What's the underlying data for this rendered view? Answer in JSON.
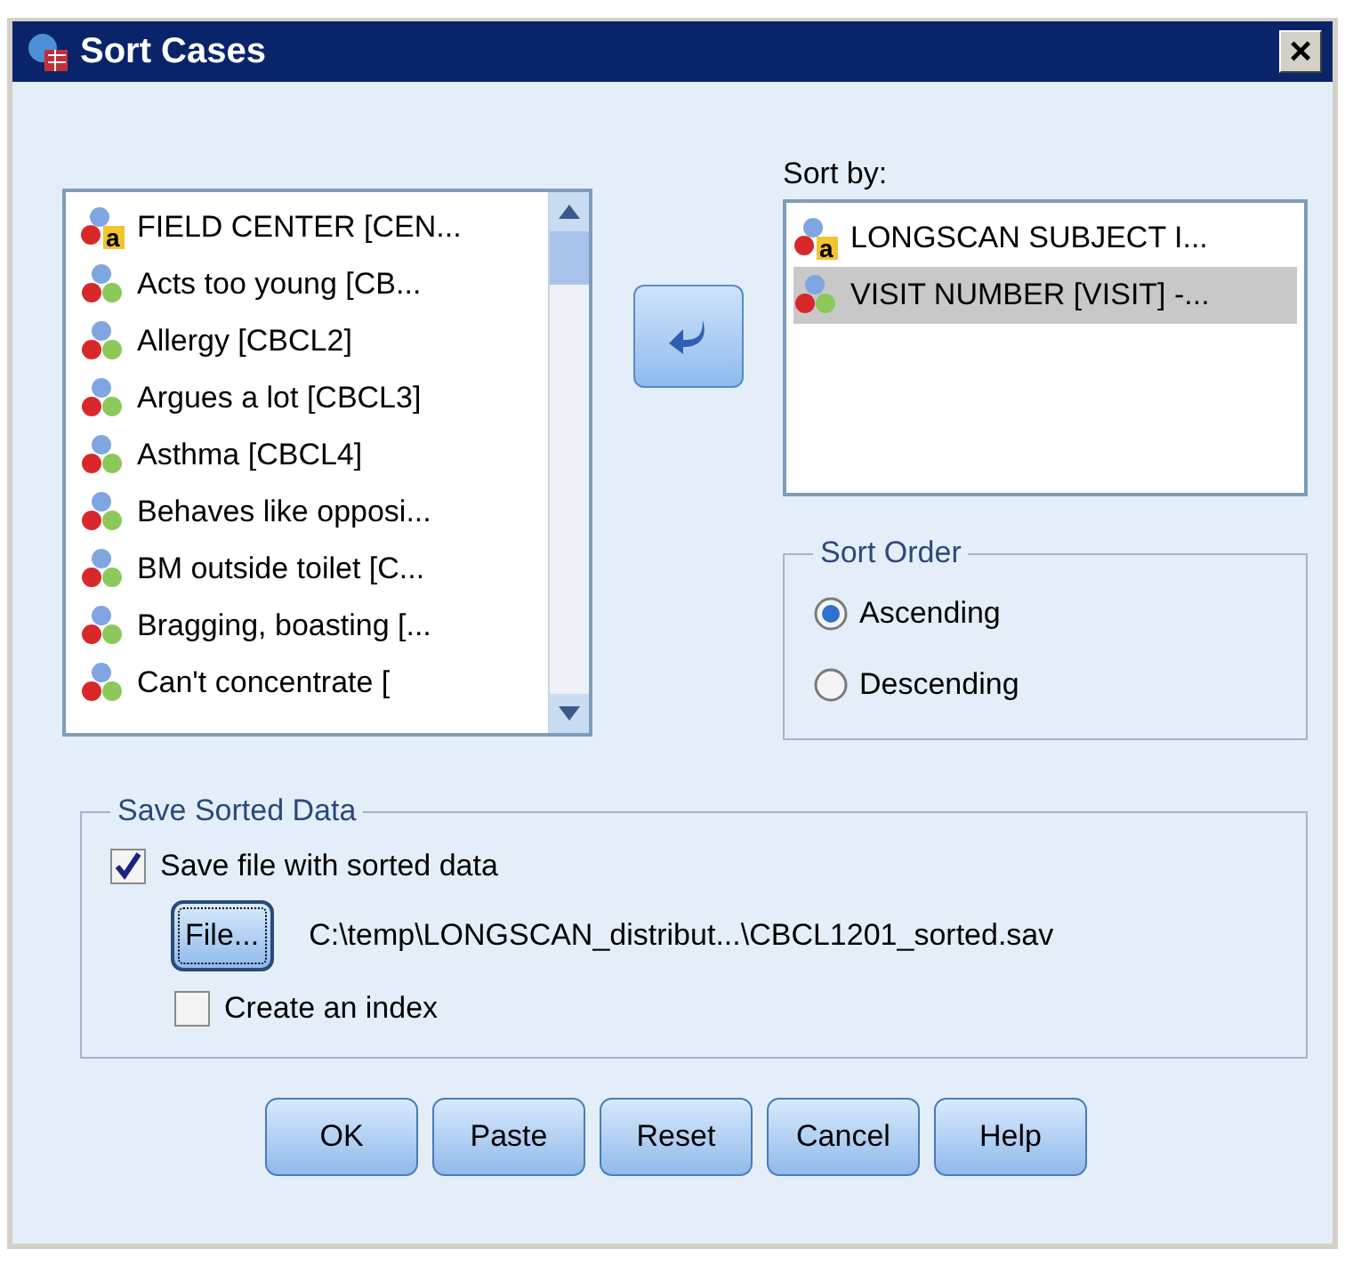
{
  "window": {
    "title": "Sort Cases",
    "close": "×"
  },
  "variables": {
    "items": [
      {
        "label": "FIELD CENTER [CEN...",
        "kind": "string",
        "icon_letter": "a"
      },
      {
        "label": "Acts too young [CB...",
        "kind": "numeric"
      },
      {
        "label": "Allergy [CBCL2]",
        "kind": "numeric"
      },
      {
        "label": "Argues a lot [CBCL3]",
        "kind": "numeric"
      },
      {
        "label": "Asthma [CBCL4]",
        "kind": "numeric"
      },
      {
        "label": "Behaves like opposi...",
        "kind": "numeric"
      },
      {
        "label": "BM outside toilet [C...",
        "kind": "numeric"
      },
      {
        "label": "Bragging, boasting [...",
        "kind": "numeric"
      },
      {
        "label": "Can't concentrate [",
        "kind": "numeric"
      }
    ]
  },
  "sort_by": {
    "label": "Sort by:",
    "items": [
      {
        "label": "LONGSCAN SUBJECT I...",
        "kind": "string",
        "icon_letter": "a",
        "selected": false
      },
      {
        "label": "VISIT NUMBER [VISIT] -...",
        "kind": "numeric",
        "selected": true
      }
    ]
  },
  "sort_order": {
    "title": "Sort Order",
    "options": [
      {
        "label": "Ascending",
        "selected": true
      },
      {
        "label": "Descending",
        "selected": false
      }
    ]
  },
  "save_sorted_data": {
    "title": "Save Sorted Data",
    "save_file": {
      "label": "Save file with sorted data",
      "checked": true
    },
    "file_button": "File...",
    "path": "C:\\temp\\LONGSCAN_distribut...\\CBCL1201_sorted.sav",
    "create_index": {
      "label": "Create an index",
      "checked": false
    }
  },
  "buttons": [
    "OK",
    "Paste",
    "Reset",
    "Cancel",
    "Help"
  ]
}
